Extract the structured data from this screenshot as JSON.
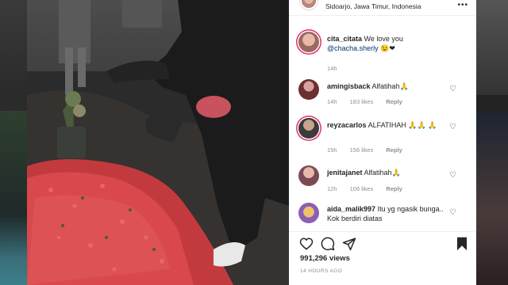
{
  "post": {
    "location": "Sidoarjo, Jawa Timur, Indonesia",
    "caption": {
      "username": "cita_citata",
      "text": "We love you",
      "mention": "@chacha.sherly",
      "emoji": "😉❤",
      "time": "14h"
    },
    "views": "991,296 views",
    "time_ago": "14 HOURS AGO"
  },
  "comments": [
    {
      "username": "amingisback",
      "text": "Alfatihah🙏",
      "time": "14h",
      "likes": "183 likes",
      "reply": "Reply"
    },
    {
      "username": "reyzacarlos",
      "text": "ALFATIHAH 🙏🙏 🙏",
      "time": "15h",
      "likes": "156 likes",
      "reply": "Reply"
    },
    {
      "username": "jenitajanet",
      "text": "Alfatihah🙏",
      "time": "12h",
      "likes": "106 likes",
      "reply": "Reply"
    },
    {
      "username": "aida_malik997",
      "text": "Itu yg ngasik bunga.. Kok berdiri diatas",
      "time": "",
      "likes": "",
      "reply": ""
    }
  ],
  "icons": {
    "more": "more-icon",
    "heart": "heart-icon",
    "comment": "comment-icon",
    "share": "share-icon",
    "save": "bookmark-icon"
  }
}
